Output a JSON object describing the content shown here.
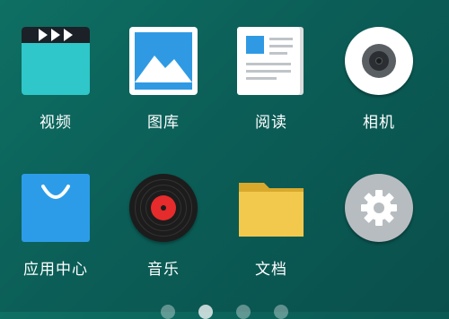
{
  "apps": [
    {
      "label": "视频",
      "icon": "video-icon"
    },
    {
      "label": "图库",
      "icon": "gallery-icon"
    },
    {
      "label": "阅读",
      "icon": "reader-icon"
    },
    {
      "label": "相机",
      "icon": "camera-icon"
    },
    {
      "label": "应用中心",
      "icon": "app-store-icon"
    },
    {
      "label": "音乐",
      "icon": "music-icon"
    },
    {
      "label": "文档",
      "icon": "folder-icon"
    },
    {
      "label": "",
      "icon": "settings-gear-icon"
    }
  ],
  "colors": {
    "background": "#0b5e57",
    "video": "#2fc7c9",
    "gallery_blue": "#2f9ae3",
    "store": "#2d9ce8",
    "record_label": "#e52b2b",
    "folder": "#f2c94c",
    "settings": "#b7bcc0"
  },
  "pager": {
    "page_count": 4,
    "active_index": 1
  }
}
